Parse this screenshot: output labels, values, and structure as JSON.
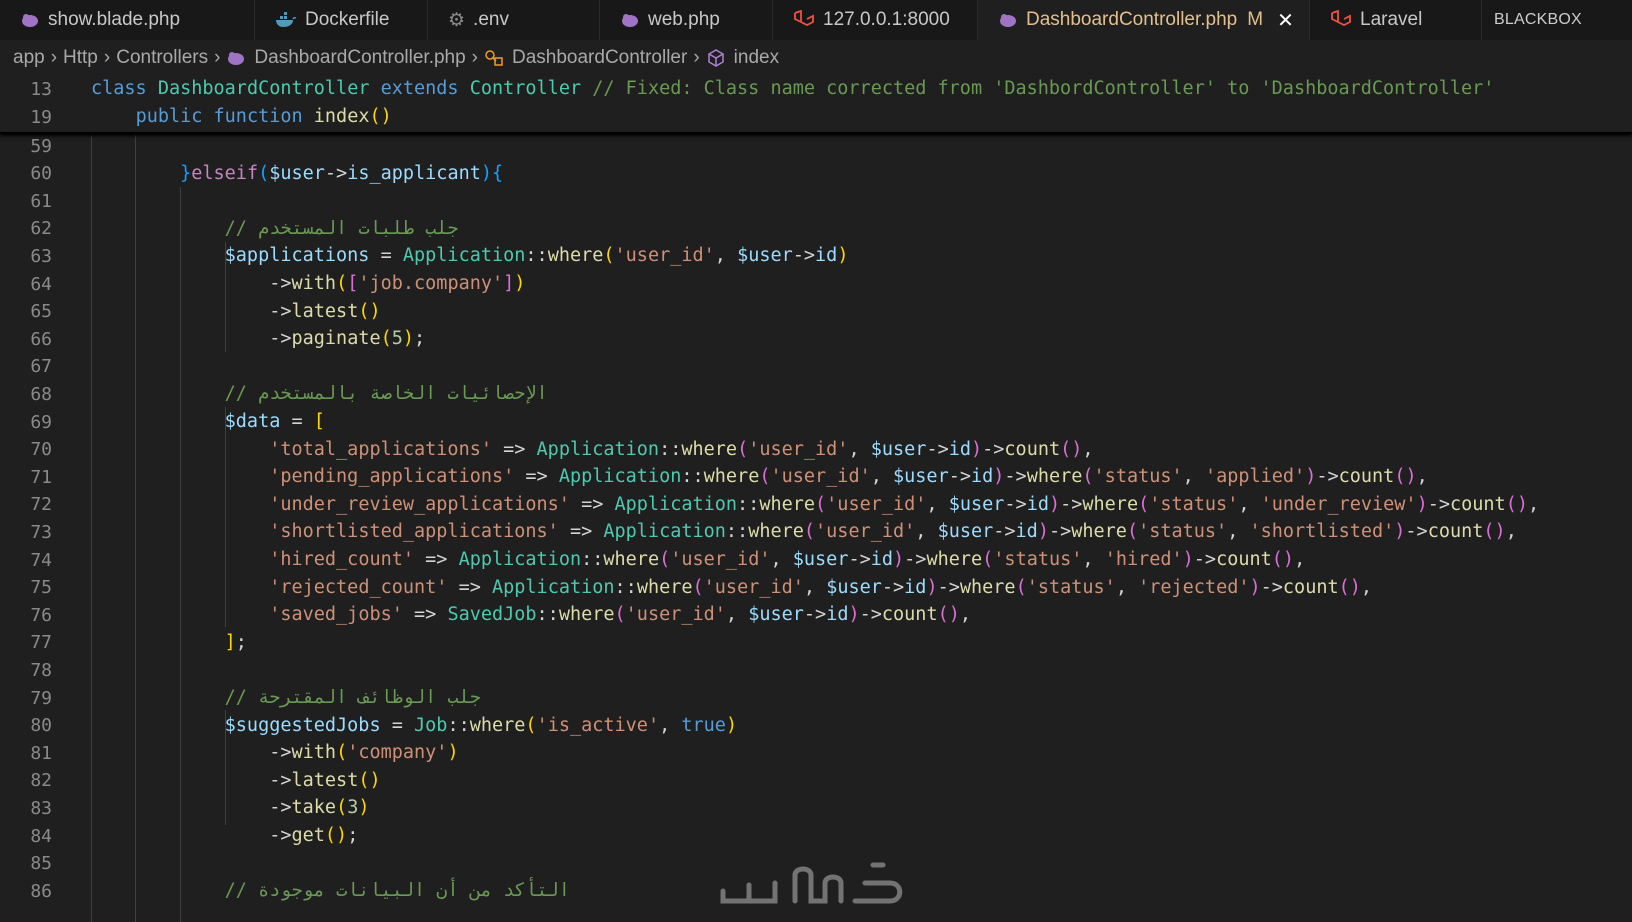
{
  "tabs": [
    {
      "label": "show.blade.php",
      "icon": "elephant-icon",
      "color": "#a074c4"
    },
    {
      "label": "Dockerfile",
      "icon": "docker-icon",
      "color": "#519aba"
    },
    {
      "label": ".env",
      "icon": "gear-icon",
      "color": "#8a8a8a"
    },
    {
      "label": "web.php",
      "icon": "elephant-icon",
      "color": "#a074c4"
    },
    {
      "label": "127.0.0.1:8000",
      "icon": "laravel-icon",
      "color": "#f05340"
    },
    {
      "label": "DashboardController.php",
      "icon": "elephant-icon",
      "color": "#a074c4",
      "modified": "M",
      "active": true
    },
    {
      "label": "Laravel",
      "icon": "laravel-icon",
      "color": "#f05340"
    },
    {
      "label": "BLACKBOX"
    }
  ],
  "breadcrumb": {
    "app": "app",
    "http": "Http",
    "controllers": "Controllers",
    "file": "DashboardController.php",
    "class": "DashboardController",
    "method": "index"
  },
  "sticky": [
    {
      "n": "13"
    },
    {
      "n": "19"
    }
  ],
  "lines": [
    "59",
    "60",
    "61",
    "62",
    "63",
    "64",
    "65",
    "66",
    "67",
    "68",
    "69",
    "70",
    "71",
    "72",
    "73",
    "74",
    "75",
    "76",
    "77",
    "78",
    "79",
    "80",
    "81",
    "82",
    "83",
    "84",
    "85",
    "86"
  ],
  "text": {
    "comment_fix": "// Fixed: Class name corrected from 'DashbordController' to 'DashboardController'",
    "comment_62": "// جلب طلبات المستخدم",
    "comment_68": "// الإحصائيات الخاصة بالمستخدم",
    "comment_79": "// جلب الوظائف المقترحة",
    "comment_86": "// التأكد من أن البيانات موجودة"
  },
  "watermark": "خمسات"
}
